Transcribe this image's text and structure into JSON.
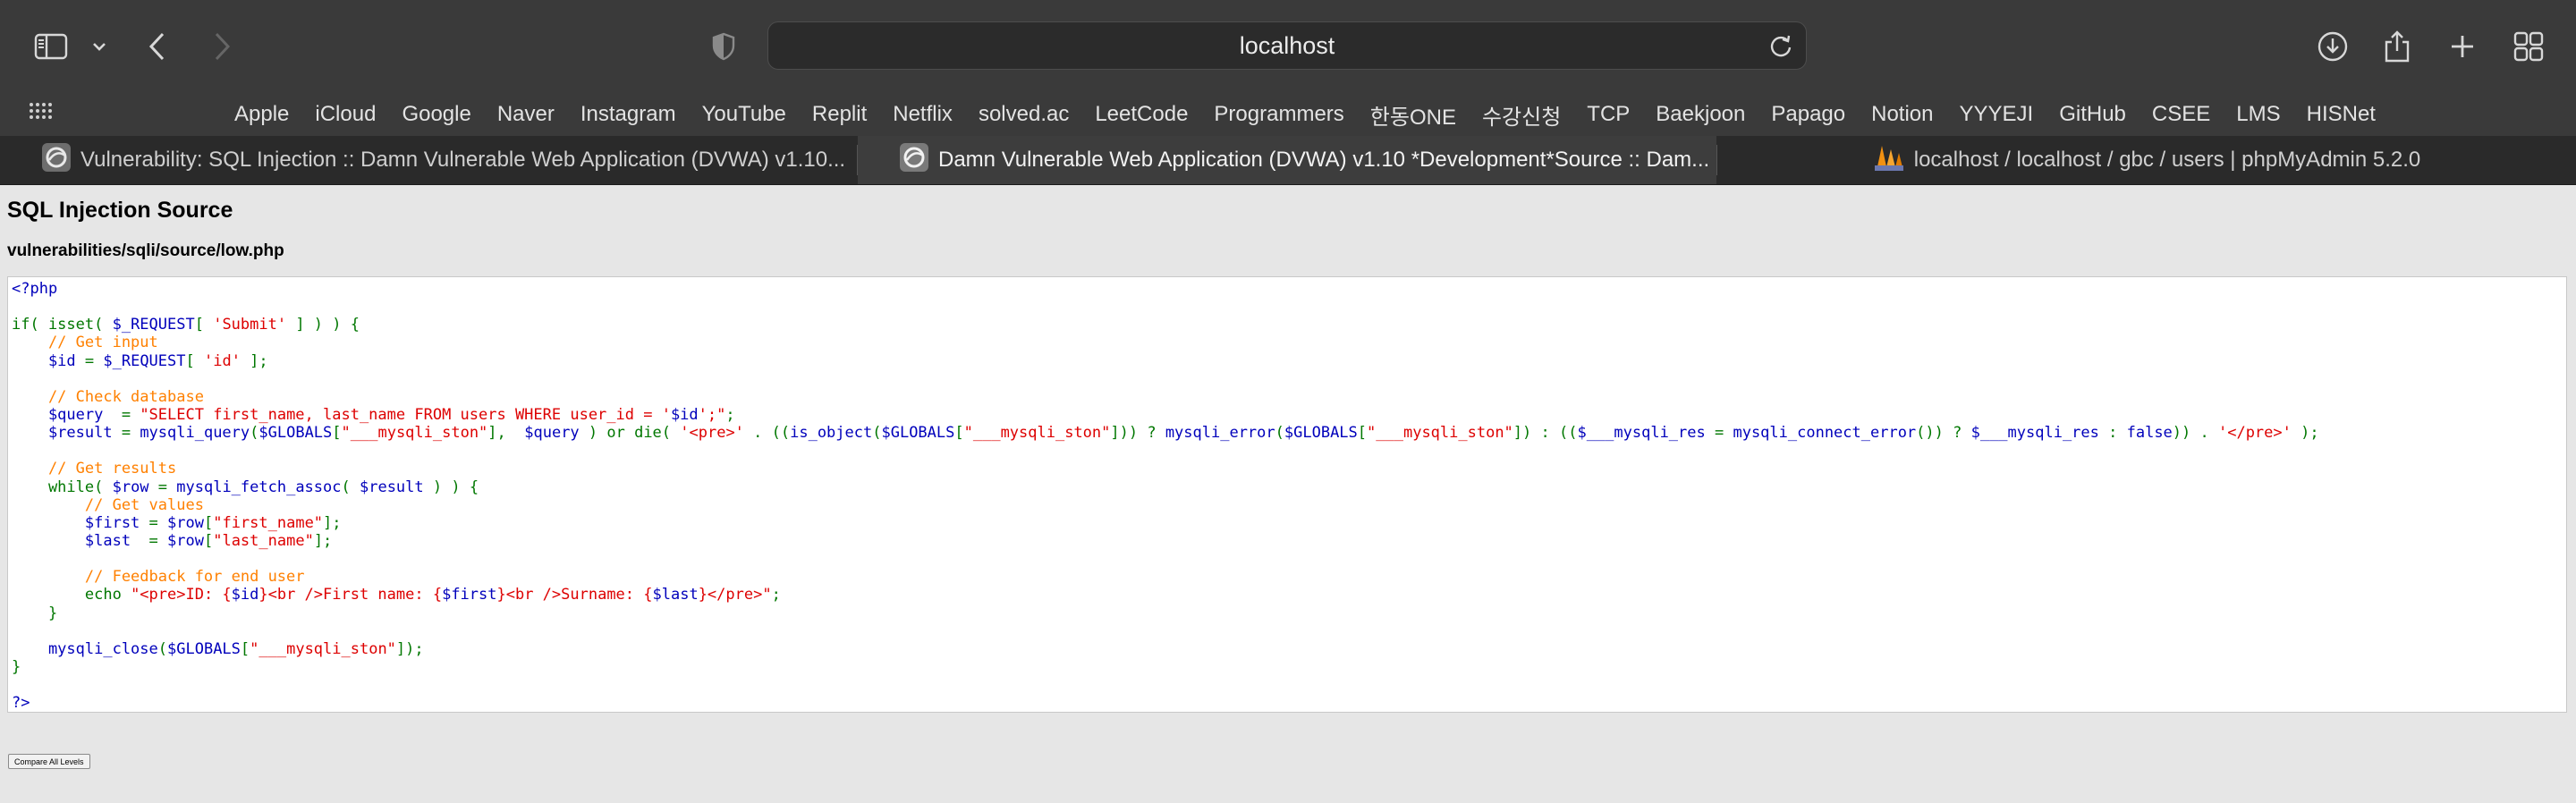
{
  "browser": {
    "address": "localhost",
    "icons": {
      "sidebar": "sidebar-icon",
      "sidebar_menu": "chevron-down-icon",
      "back": "back-arrow-icon",
      "forward": "forward-arrow-icon",
      "privacy": "shield-icon",
      "reload": "reload-icon",
      "downloads": "download-icon",
      "share": "share-icon",
      "new_tab": "plus-icon",
      "tab_overview": "tab-overview-icon",
      "favorites": "grid-icon"
    },
    "bookmarks": [
      "Apple",
      "iCloud",
      "Google",
      "Naver",
      "Instagram",
      "YouTube",
      "Replit",
      "Netflix",
      "solved.ac",
      "LeetCode",
      "Programmers",
      "한동ONE",
      "수강신청",
      "TCP",
      "Baekjoon",
      "Papago",
      "Notion",
      "YYYEJI",
      "GitHub",
      "CSEE",
      "LMS",
      "HISNet"
    ],
    "tabs": [
      {
        "title": "Vulnerability: SQL Injection :: Damn Vulnerable Web Application (DVWA) v1.10...",
        "active": false
      },
      {
        "title": "Damn Vulnerable Web Application (DVWA) v1.10 *Development*Source :: Dam...",
        "active": true
      },
      {
        "title": "localhost / localhost / gbc / users | phpMyAdmin 5.2.0",
        "active": false
      }
    ]
  },
  "page": {
    "title": "SQL Injection Source",
    "file_path": "vulnerabilities/sqli/source/low.php",
    "compare_button": "Compare All Levels",
    "code_colors": {
      "default": "#007700",
      "keyword": "#0000bb",
      "string": "#dd0000",
      "comment": "#ff8000"
    },
    "code_lines": [
      [
        [
          "k",
          "<?php"
        ]
      ],
      [],
      [
        [
          "d",
          "if( isset( "
        ],
        [
          "k",
          "$_REQUEST"
        ],
        [
          "d",
          "[ "
        ],
        [
          "s",
          "'Submit'"
        ],
        [
          "d",
          " ] ) ) {"
        ]
      ],
      [
        [
          "c",
          "    // Get input"
        ]
      ],
      [
        [
          "k",
          "    $id "
        ],
        [
          "d",
          "= "
        ],
        [
          "k",
          "$_REQUEST"
        ],
        [
          "d",
          "[ "
        ],
        [
          "s",
          "'id'"
        ],
        [
          "d",
          " ];"
        ]
      ],
      [],
      [
        [
          "c",
          "    // Check database"
        ]
      ],
      [
        [
          "k",
          "    $query  "
        ],
        [
          "d",
          "= "
        ],
        [
          "s",
          "\"SELECT first_name, last_name FROM users WHERE user_id = '"
        ],
        [
          "k",
          "$id"
        ],
        [
          "s",
          "';\""
        ],
        [
          "d",
          ";"
        ]
      ],
      [
        [
          "k",
          "    $result "
        ],
        [
          "d",
          "= "
        ],
        [
          "k",
          "mysqli_query"
        ],
        [
          "d",
          "("
        ],
        [
          "k",
          "$GLOBALS"
        ],
        [
          "d",
          "["
        ],
        [
          "s",
          "\"___mysqli_ston\""
        ],
        [
          "d",
          "],  "
        ],
        [
          "k",
          "$query "
        ],
        [
          "d",
          ") or die( "
        ],
        [
          "s",
          "'<pre>' "
        ],
        [
          "d",
          ". (("
        ],
        [
          "k",
          "is_object"
        ],
        [
          "d",
          "("
        ],
        [
          "k",
          "$GLOBALS"
        ],
        [
          "d",
          "["
        ],
        [
          "s",
          "\"___mysqli_ston\""
        ],
        [
          "d",
          "])) ? "
        ],
        [
          "k",
          "mysqli_error"
        ],
        [
          "d",
          "("
        ],
        [
          "k",
          "$GLOBALS"
        ],
        [
          "d",
          "["
        ],
        [
          "s",
          "\"___mysqli_ston\""
        ],
        [
          "d",
          "]) : (("
        ],
        [
          "k",
          "$___mysqli_res "
        ],
        [
          "d",
          "= "
        ],
        [
          "k",
          "mysqli_connect_error"
        ],
        [
          "d",
          "()) ? "
        ],
        [
          "k",
          "$___mysqli_res "
        ],
        [
          "d",
          ": "
        ],
        [
          "k",
          "false"
        ],
        [
          "d",
          ")) . "
        ],
        [
          "s",
          "'</pre>' "
        ],
        [
          "d",
          ");"
        ]
      ],
      [],
      [
        [
          "c",
          "    // Get results"
        ]
      ],
      [
        [
          "d",
          "    while( "
        ],
        [
          "k",
          "$row "
        ],
        [
          "d",
          "= "
        ],
        [
          "k",
          "mysqli_fetch_assoc"
        ],
        [
          "d",
          "( "
        ],
        [
          "k",
          "$result "
        ],
        [
          "d",
          ") ) {"
        ]
      ],
      [
        [
          "c",
          "        // Get values"
        ]
      ],
      [
        [
          "k",
          "        $first "
        ],
        [
          "d",
          "= "
        ],
        [
          "k",
          "$row"
        ],
        [
          "d",
          "["
        ],
        [
          "s",
          "\"first_name\""
        ],
        [
          "d",
          "];"
        ]
      ],
      [
        [
          "k",
          "        $last  "
        ],
        [
          "d",
          "= "
        ],
        [
          "k",
          "$row"
        ],
        [
          "d",
          "["
        ],
        [
          "s",
          "\"last_name\""
        ],
        [
          "d",
          "];"
        ]
      ],
      [],
      [
        [
          "c",
          "        // Feedback for end user"
        ]
      ],
      [
        [
          "d",
          "        echo "
        ],
        [
          "s",
          "\"<pre>ID: {"
        ],
        [
          "k",
          "$id"
        ],
        [
          "s",
          "}<br />First name: {"
        ],
        [
          "k",
          "$first"
        ],
        [
          "s",
          "}<br />Surname: {"
        ],
        [
          "k",
          "$last"
        ],
        [
          "s",
          "}</pre>\""
        ],
        [
          "d",
          ";"
        ]
      ],
      [
        [
          "d",
          "    }"
        ]
      ],
      [],
      [
        [
          "k",
          "    mysqli_close"
        ],
        [
          "d",
          "("
        ],
        [
          "k",
          "$GLOBALS"
        ],
        [
          "d",
          "["
        ],
        [
          "s",
          "\"___mysqli_ston\""
        ],
        [
          "d",
          "]);"
        ]
      ],
      [
        [
          "d",
          "}"
        ]
      ],
      [],
      [
        [
          "k",
          "?>"
        ]
      ]
    ]
  }
}
